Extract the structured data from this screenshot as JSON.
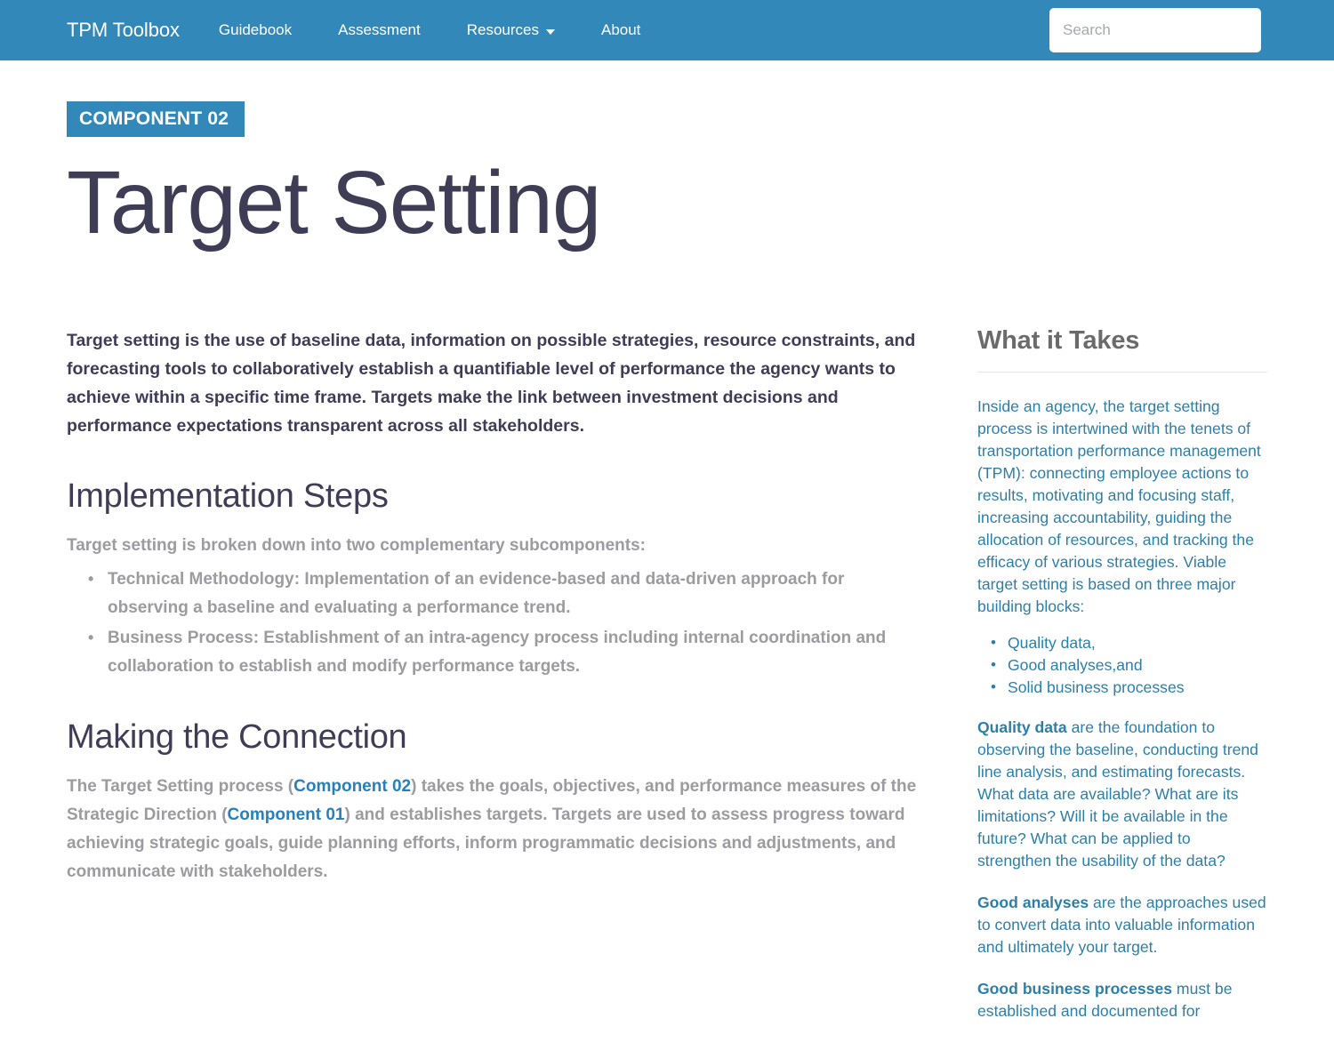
{
  "navbar": {
    "brand": "TPM Toolbox",
    "links": [
      {
        "label": "Guidebook",
        "icon": null
      },
      {
        "label": "Assessment",
        "icon": null
      },
      {
        "label": "Resources",
        "icon": "chevron-down-icon"
      },
      {
        "label": "About",
        "icon": null
      }
    ],
    "search": {
      "placeholder": "Search",
      "value": ""
    },
    "background_color": "#3288b8"
  },
  "header": {
    "badge": "COMPONENT 02",
    "badge_color": "#3288b8",
    "title": "Target Setting",
    "title_color": "#3f3d56"
  },
  "main": {
    "lead": "Target setting is the use of baseline data, information on possible strategies, resource constraints, and forecasting tools to collaboratively establish a quantifiable level of performance the agency wants to achieve within a specific time frame. Targets make the link between investment decisions and performance expectations transparent across all stakeholders.",
    "sections": [
      {
        "heading": "Implementation Steps",
        "intro": "Target setting is broken down into two complementary subcomponents:",
        "bullets": [
          "Technical Methodology: Implementation of an evidence-based and data-driven approach for observing a baseline and evaluating a performance trend.",
          "Business Process: Establishment of an intra-agency process including internal coordination and collaboration to establish and modify performance targets."
        ]
      },
      {
        "heading": "Making the Connection",
        "paragraph_part1": "The Target Setting process (",
        "link1": "Component 02",
        "paragraph_part2": ") takes the goals, objectives, and performance measures of the Strategic Direction (",
        "link2": "Component 01",
        "paragraph_part3": ") and establishes targets. Targets are used to assess progress toward achieving strategic goals, guide planning efforts, inform programmatic decisions and adjustments, and communicate with stakeholders.",
        "link_color": "#2980b9"
      }
    ]
  },
  "sidebar": {
    "heading": "What it Takes",
    "heading_color": "#6b6b6b",
    "text_color": "#2d7fa8",
    "intro": "Inside an agency, the target setting process is intertwined with the tenets of transportation performance management (TPM): connecting employee actions to results, motivating and focusing staff, increasing accountability, guiding the allocation of resources, and tracking the efficacy of various strategies. Viable target setting is based on three major building blocks:",
    "bullets": [
      "Quality data,",
      "Good analyses,and",
      "Solid business processes"
    ],
    "paragraphs": [
      {
        "bold": "Quality data",
        "rest": " are the foundation to observing the baseline, conducting trend line analysis, and estimating forecasts. What data are available? What are its limitations? Will it be available in the future? What can be applied to strengthen the usability of the data?"
      },
      {
        "bold": "Good analyses",
        "rest": " are the approaches used to convert data into valuable information and ultimately your target."
      },
      {
        "bold": "Good business processes",
        "rest": " must be established and documented for"
      }
    ]
  }
}
